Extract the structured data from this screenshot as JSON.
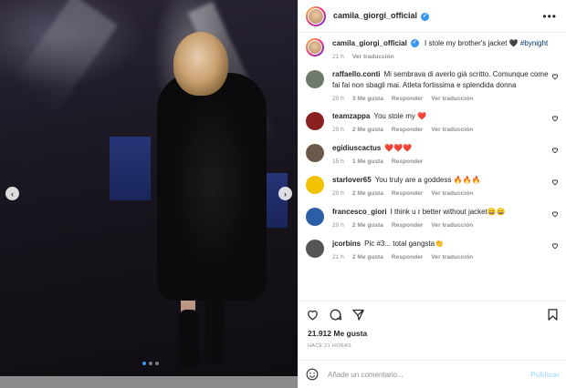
{
  "post": {
    "username": "camila_giorgi_official",
    "more_label": "•••",
    "caption": {
      "username": "camila_giorgi_official",
      "text": "I stole my brother's jacket 🖤",
      "hashtag": "#bynight",
      "time": "21 h",
      "translate": "Ver traducción"
    },
    "photo": {
      "prev_label": "‹",
      "next_label": "›",
      "dots_count": 3,
      "active_dot": 0
    }
  },
  "comments": [
    {
      "username": "raffaello.conti",
      "text": "Mi sembrava di averlo già scritto. Comunque come fai fai non sbagli mai. Atleta fortissima e splendida donna",
      "time": "20 h",
      "likes": "3 Me gusta",
      "reply": "Responder",
      "translate": "Ver traducción",
      "avatar_color": "#6f7b6a"
    },
    {
      "username": "teamzappa",
      "text": "You stole my ❤️",
      "time": "20 h",
      "likes": "2 Me gusta",
      "reply": "Responder",
      "translate": "Ver traducción",
      "avatar_color": "#8a2020"
    },
    {
      "username": "egidiuscactus",
      "text": "❤️❤️❤️",
      "time": "15 h",
      "likes": "1 Me gusta",
      "reply": "Responder",
      "translate": "",
      "avatar_color": "#6b5a4a"
    },
    {
      "username": "starlover65",
      "text": "You truly are a goddess 🔥🔥🔥",
      "time": "20 h",
      "likes": "2 Me gusta",
      "reply": "Responder",
      "translate": "Ver traducción",
      "avatar_color": "#f2c200"
    },
    {
      "username": "francesco_giori",
      "text": "I think u r better without jacket😄😄",
      "time": "20 h",
      "likes": "2 Me gusta",
      "reply": "Responder",
      "translate": "Ver traducción",
      "avatar_color": "#2a5fa8"
    },
    {
      "username": "jcorbins",
      "text": "Pic #3... total gangsta👏",
      "time": "21 h",
      "likes": "2 Me gusta",
      "reply": "Responder",
      "translate": "Ver traducción",
      "avatar_color": "#555555"
    }
  ],
  "stats": {
    "likes": "21.912 Me gusta",
    "when": "HACE 21 HORAS"
  },
  "add_comment": {
    "placeholder": "Añade un comentario...",
    "publish": "Publicar"
  },
  "colors": {
    "accent": "#3897f0",
    "link": "#00376b",
    "muted": "#8e8e8e"
  }
}
